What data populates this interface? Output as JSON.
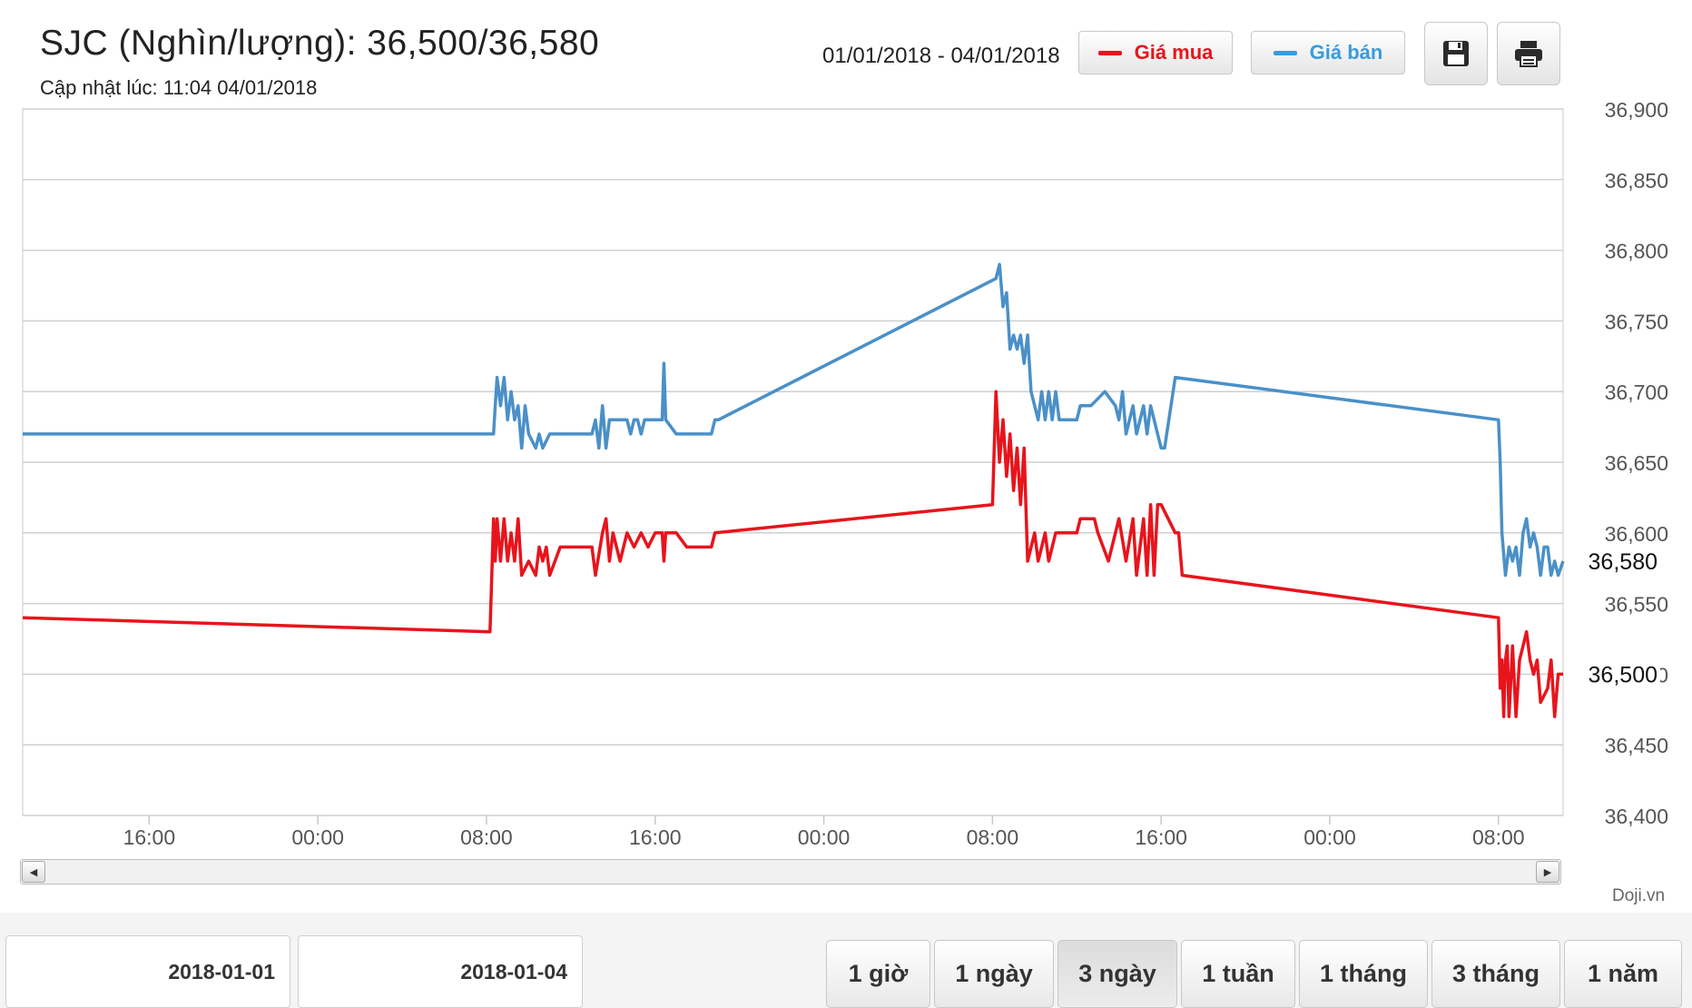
{
  "header": {
    "title": "SJC (Nghìn/lượng): 36,500/36,580",
    "updated": "Cập nhật lúc: 11:04 04/01/2018",
    "date_range": "01/01/2018 - 04/01/2018"
  },
  "toolbar": {
    "save_icon": "floppy-disk-icon",
    "print_icon": "printer-icon"
  },
  "credit": "Doji.vn",
  "date_inputs": {
    "from": "2018-01-01",
    "to": "2018-01-04"
  },
  "periods": [
    {
      "label": "1 giờ",
      "active": false
    },
    {
      "label": "1 ngày",
      "active": false
    },
    {
      "label": "3 ngày",
      "active": true
    },
    {
      "label": "1 tuần",
      "active": false
    },
    {
      "label": "1 tháng",
      "active": false
    },
    {
      "label": "3 tháng",
      "active": false
    },
    {
      "label": "1 năm",
      "active": false
    }
  ],
  "chart_data": {
    "type": "line",
    "title": "",
    "xlabel": "",
    "ylabel": "",
    "ylim": [
      36400,
      36900
    ],
    "yticks": [
      36400,
      36450,
      36500,
      36550,
      36600,
      36650,
      36700,
      36750,
      36800,
      36850,
      36900
    ],
    "ytick_labels": [
      "36,400",
      "36,450",
      "36,500",
      "36,550",
      "36,600",
      "36,650",
      "36,700",
      "36,750",
      "36,800",
      "36,850",
      "36,900"
    ],
    "xlim": [
      "2018-01-01 10:00",
      "2018-01-04 11:04"
    ],
    "xticks": [
      "2018-01-01 16:00",
      "2018-01-02 00:00",
      "2018-01-02 08:00",
      "2018-01-02 16:00",
      "2018-01-03 00:00",
      "2018-01-03 08:00",
      "2018-01-03 16:00",
      "2018-01-04 00:00",
      "2018-01-04 08:00"
    ],
    "xtick_labels": [
      "16:00",
      "00:00",
      "08:00",
      "16:00",
      "00:00",
      "08:00",
      "16:00",
      "00:00",
      "08:00"
    ],
    "grid": true,
    "legend": "top",
    "series": [
      {
        "name": "Giá mua",
        "color": "#e8141c",
        "last_label": "36,500",
        "points": [
          [
            "2018-01-01 10:00",
            36540
          ],
          [
            "2018-01-02 08:10",
            36530
          ],
          [
            "2018-01-02 08:15",
            36570
          ],
          [
            "2018-01-02 08:20",
            36610
          ],
          [
            "2018-01-02 08:25",
            36580
          ],
          [
            "2018-01-02 08:30",
            36610
          ],
          [
            "2018-01-02 08:40",
            36580
          ],
          [
            "2018-01-02 08:50",
            36610
          ],
          [
            "2018-01-02 09:00",
            36580
          ],
          [
            "2018-01-02 09:10",
            36600
          ],
          [
            "2018-01-02 09:20",
            36580
          ],
          [
            "2018-01-02 09:30",
            36610
          ],
          [
            "2018-01-02 09:40",
            36570
          ],
          [
            "2018-01-02 10:00",
            36580
          ],
          [
            "2018-01-02 10:20",
            36570
          ],
          [
            "2018-01-02 10:30",
            36590
          ],
          [
            "2018-01-02 10:40",
            36580
          ],
          [
            "2018-01-02 10:50",
            36590
          ],
          [
            "2018-01-02 11:00",
            36570
          ],
          [
            "2018-01-02 11:30",
            36590
          ],
          [
            "2018-01-02 13:00",
            36590
          ],
          [
            "2018-01-02 13:10",
            36570
          ],
          [
            "2018-01-02 13:30",
            36600
          ],
          [
            "2018-01-02 13:40",
            36610
          ],
          [
            "2018-01-02 13:50",
            36580
          ],
          [
            "2018-01-02 14:00",
            36600
          ],
          [
            "2018-01-02 14:20",
            36580
          ],
          [
            "2018-01-02 14:40",
            36600
          ],
          [
            "2018-01-02 15:00",
            36590
          ],
          [
            "2018-01-02 15:20",
            36600
          ],
          [
            "2018-01-02 15:40",
            36590
          ],
          [
            "2018-01-02 16:00",
            36600
          ],
          [
            "2018-01-02 16:20",
            36600
          ],
          [
            "2018-01-02 16:25",
            36580
          ],
          [
            "2018-01-02 16:30",
            36600
          ],
          [
            "2018-01-02 17:00",
            36600
          ],
          [
            "2018-01-02 17:30",
            36590
          ],
          [
            "2018-01-02 18:40",
            36590
          ],
          [
            "2018-01-02 18:50",
            36600
          ],
          [
            "2018-01-03 08:00",
            36620
          ],
          [
            "2018-01-03 08:10",
            36700
          ],
          [
            "2018-01-03 08:20",
            36650
          ],
          [
            "2018-01-03 08:30",
            36680
          ],
          [
            "2018-01-03 08:40",
            36640
          ],
          [
            "2018-01-03 08:50",
            36670
          ],
          [
            "2018-01-03 09:00",
            36630
          ],
          [
            "2018-01-03 09:10",
            36660
          ],
          [
            "2018-01-03 09:20",
            36620
          ],
          [
            "2018-01-03 09:30",
            36660
          ],
          [
            "2018-01-03 09:40",
            36580
          ],
          [
            "2018-01-03 10:00",
            36600
          ],
          [
            "2018-01-03 10:10",
            36580
          ],
          [
            "2018-01-03 10:30",
            36600
          ],
          [
            "2018-01-03 10:40",
            36580
          ],
          [
            "2018-01-03 11:00",
            36600
          ],
          [
            "2018-01-03 12:00",
            36600
          ],
          [
            "2018-01-03 12:10",
            36610
          ],
          [
            "2018-01-03 12:50",
            36610
          ],
          [
            "2018-01-03 13:00",
            36600
          ],
          [
            "2018-01-03 13:30",
            36580
          ],
          [
            "2018-01-03 14:00",
            36610
          ],
          [
            "2018-01-03 14:20",
            36580
          ],
          [
            "2018-01-03 14:40",
            36610
          ],
          [
            "2018-01-03 14:50",
            36570
          ],
          [
            "2018-01-03 15:10",
            36610
          ],
          [
            "2018-01-03 15:20",
            36570
          ],
          [
            "2018-01-03 15:30",
            36620
          ],
          [
            "2018-01-03 15:40",
            36570
          ],
          [
            "2018-01-03 15:50",
            36620
          ],
          [
            "2018-01-03 16:00",
            36620
          ],
          [
            "2018-01-03 16:40",
            36600
          ],
          [
            "2018-01-03 16:50",
            36600
          ],
          [
            "2018-01-03 17:00",
            36570
          ],
          [
            "2018-01-04 08:00",
            36540
          ],
          [
            "2018-01-04 08:05",
            36490
          ],
          [
            "2018-01-04 08:10",
            36510
          ],
          [
            "2018-01-04 08:15",
            36470
          ],
          [
            "2018-01-04 08:20",
            36510
          ],
          [
            "2018-01-04 08:25",
            36520
          ],
          [
            "2018-01-04 08:30",
            36470
          ],
          [
            "2018-01-04 08:40",
            36520
          ],
          [
            "2018-01-04 08:50",
            36470
          ],
          [
            "2018-01-04 09:00",
            36510
          ],
          [
            "2018-01-04 09:10",
            36520
          ],
          [
            "2018-01-04 09:20",
            36530
          ],
          [
            "2018-01-04 09:30",
            36510
          ],
          [
            "2018-01-04 09:40",
            36500
          ],
          [
            "2018-01-04 09:50",
            36510
          ],
          [
            "2018-01-04 10:00",
            36480
          ],
          [
            "2018-01-04 10:20",
            36490
          ],
          [
            "2018-01-04 10:30",
            36510
          ],
          [
            "2018-01-04 10:40",
            36470
          ],
          [
            "2018-01-04 10:50",
            36500
          ],
          [
            "2018-01-04 11:04",
            36500
          ]
        ]
      },
      {
        "name": "Giá bán",
        "color": "#4a90c8",
        "last_label": "36,580",
        "points": [
          [
            "2018-01-01 10:00",
            36670
          ],
          [
            "2018-01-02 08:20",
            36670
          ],
          [
            "2018-01-02 08:25",
            36690
          ],
          [
            "2018-01-02 08:30",
            36710
          ],
          [
            "2018-01-02 08:40",
            36690
          ],
          [
            "2018-01-02 08:50",
            36710
          ],
          [
            "2018-01-02 09:00",
            36680
          ],
          [
            "2018-01-02 09:10",
            36700
          ],
          [
            "2018-01-02 09:20",
            36680
          ],
          [
            "2018-01-02 09:30",
            36690
          ],
          [
            "2018-01-02 09:40",
            36660
          ],
          [
            "2018-01-02 09:50",
            36690
          ],
          [
            "2018-01-02 10:00",
            36670
          ],
          [
            "2018-01-02 10:20",
            36660
          ],
          [
            "2018-01-02 10:30",
            36670
          ],
          [
            "2018-01-02 10:40",
            36660
          ],
          [
            "2018-01-02 11:00",
            36670
          ],
          [
            "2018-01-02 13:00",
            36670
          ],
          [
            "2018-01-02 13:10",
            36680
          ],
          [
            "2018-01-02 13:20",
            36660
          ],
          [
            "2018-01-02 13:30",
            36690
          ],
          [
            "2018-01-02 13:40",
            36660
          ],
          [
            "2018-01-02 13:50",
            36680
          ],
          [
            "2018-01-02 14:40",
            36680
          ],
          [
            "2018-01-02 14:50",
            36670
          ],
          [
            "2018-01-02 15:00",
            36680
          ],
          [
            "2018-01-02 15:10",
            36680
          ],
          [
            "2018-01-02 15:20",
            36670
          ],
          [
            "2018-01-02 15:30",
            36680
          ],
          [
            "2018-01-02 16:00",
            36680
          ],
          [
            "2018-01-02 16:20",
            36680
          ],
          [
            "2018-01-02 16:25",
            36720
          ],
          [
            "2018-01-02 16:30",
            36680
          ],
          [
            "2018-01-02 17:00",
            36670
          ],
          [
            "2018-01-02 18:40",
            36670
          ],
          [
            "2018-01-02 18:50",
            36680
          ],
          [
            "2018-01-02 19:00",
            36680
          ],
          [
            "2018-01-03 08:10",
            36780
          ],
          [
            "2018-01-03 08:20",
            36790
          ],
          [
            "2018-01-03 08:30",
            36760
          ],
          [
            "2018-01-03 08:40",
            36770
          ],
          [
            "2018-01-03 08:50",
            36730
          ],
          [
            "2018-01-03 09:00",
            36740
          ],
          [
            "2018-01-03 09:10",
            36730
          ],
          [
            "2018-01-03 09:20",
            36740
          ],
          [
            "2018-01-03 09:30",
            36720
          ],
          [
            "2018-01-03 09:40",
            36740
          ],
          [
            "2018-01-03 09:50",
            36700
          ],
          [
            "2018-01-03 10:00",
            36690
          ],
          [
            "2018-01-03 10:10",
            36680
          ],
          [
            "2018-01-03 10:20",
            36700
          ],
          [
            "2018-01-03 10:30",
            36680
          ],
          [
            "2018-01-03 10:40",
            36700
          ],
          [
            "2018-01-03 10:50",
            36680
          ],
          [
            "2018-01-03 11:00",
            36700
          ],
          [
            "2018-01-03 11:10",
            36680
          ],
          [
            "2018-01-03 11:30",
            36680
          ],
          [
            "2018-01-03 12:00",
            36680
          ],
          [
            "2018-01-03 12:10",
            36690
          ],
          [
            "2018-01-03 12:40",
            36690
          ],
          [
            "2018-01-03 13:20",
            36700
          ],
          [
            "2018-01-03 13:50",
            36690
          ],
          [
            "2018-01-03 14:00",
            36680
          ],
          [
            "2018-01-03 14:10",
            36700
          ],
          [
            "2018-01-03 14:20",
            36670
          ],
          [
            "2018-01-03 14:40",
            36690
          ],
          [
            "2018-01-03 14:50",
            36670
          ],
          [
            "2018-01-03 15:10",
            36690
          ],
          [
            "2018-01-03 15:20",
            36670
          ],
          [
            "2018-01-03 15:30",
            36690
          ],
          [
            "2018-01-03 15:50",
            36670
          ],
          [
            "2018-01-03 16:00",
            36660
          ],
          [
            "2018-01-03 16:10",
            36660
          ],
          [
            "2018-01-03 16:40",
            36710
          ],
          [
            "2018-01-04 08:00",
            36680
          ],
          [
            "2018-01-04 08:05",
            36650
          ],
          [
            "2018-01-04 08:10",
            36600
          ],
          [
            "2018-01-04 08:20",
            36570
          ],
          [
            "2018-01-04 08:30",
            36590
          ],
          [
            "2018-01-04 08:40",
            36580
          ],
          [
            "2018-01-04 08:50",
            36590
          ],
          [
            "2018-01-04 09:00",
            36570
          ],
          [
            "2018-01-04 09:10",
            36600
          ],
          [
            "2018-01-04 09:20",
            36610
          ],
          [
            "2018-01-04 09:30",
            36590
          ],
          [
            "2018-01-04 09:40",
            36600
          ],
          [
            "2018-01-04 09:50",
            36590
          ],
          [
            "2018-01-04 10:00",
            36570
          ],
          [
            "2018-01-04 10:10",
            36590
          ],
          [
            "2018-01-04 10:20",
            36590
          ],
          [
            "2018-01-04 10:30",
            36570
          ],
          [
            "2018-01-04 10:40",
            36580
          ],
          [
            "2018-01-04 10:50",
            36570
          ],
          [
            "2018-01-04 11:04",
            36580
          ]
        ]
      }
    ]
  }
}
